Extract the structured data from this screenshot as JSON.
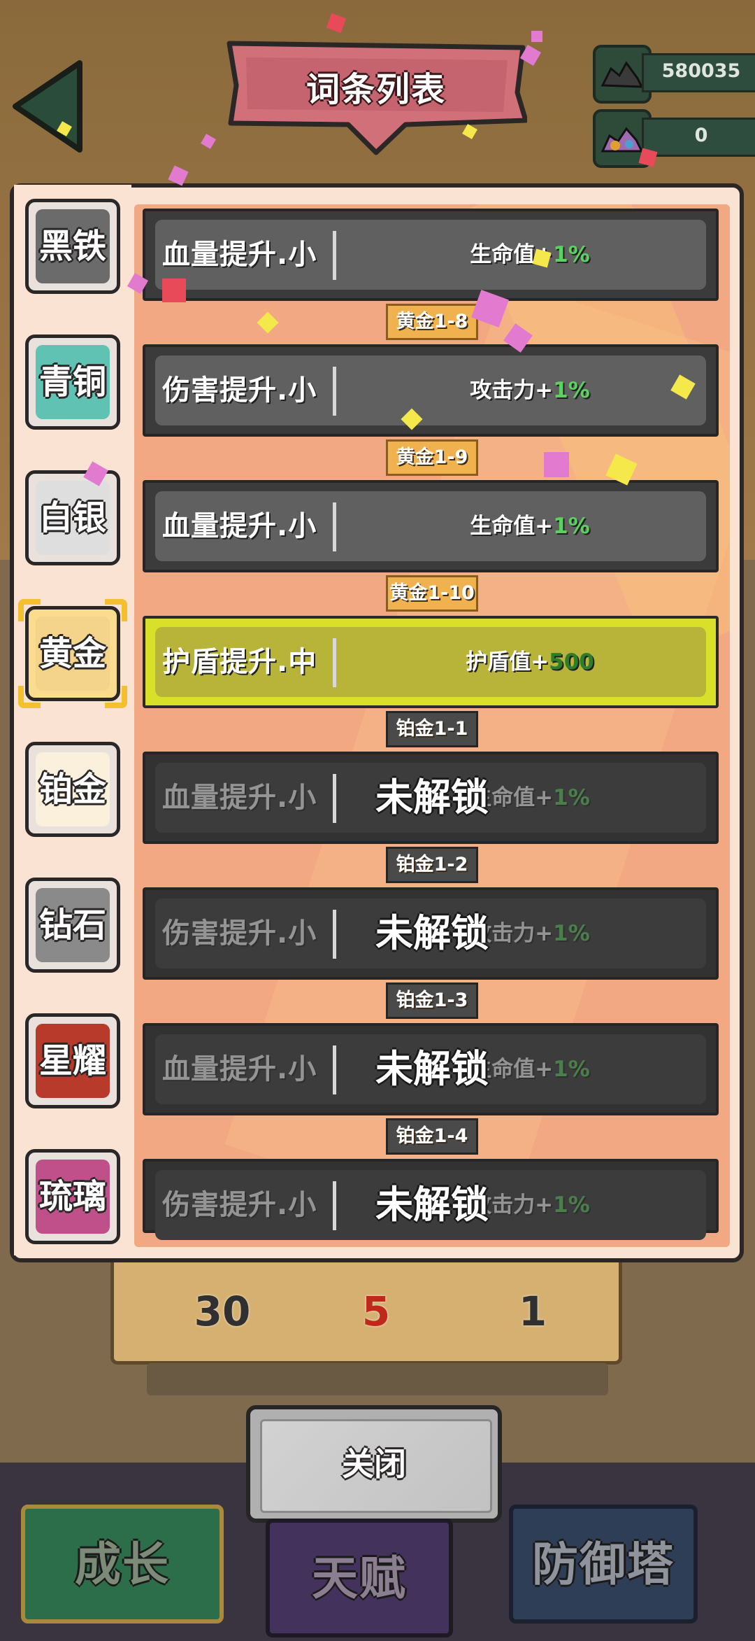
{
  "title": "词条列表",
  "resources": [
    {
      "icon": "ore-pile-icon",
      "value": "580035"
    },
    {
      "icon": "gem-pile-icon",
      "value": "0"
    }
  ],
  "tiers": [
    {
      "label": "黑铁",
      "selected": false,
      "color": "#6b6b6b"
    },
    {
      "label": "青铜",
      "selected": false,
      "color": "#5fc2b2"
    },
    {
      "label": "白银",
      "selected": false,
      "color": "#dedede"
    },
    {
      "label": "黄金",
      "selected": true,
      "color": "#f4d48a"
    },
    {
      "label": "铂金",
      "selected": false,
      "color": "#fbf0dc"
    },
    {
      "label": "钻石",
      "selected": false,
      "color": "#8a8a8a"
    },
    {
      "label": "星耀",
      "selected": false,
      "color": "#b83a2a"
    },
    {
      "label": "琉璃",
      "selected": false,
      "color": "#c0508a"
    }
  ],
  "rows": [
    {
      "name": "血量提升.小",
      "effect_label": "生命值+",
      "effect_value": "1%",
      "state": "normal"
    },
    {
      "name": "伤害提升.小",
      "effect_label": "攻击力+",
      "effect_value": "1%",
      "state": "normal"
    },
    {
      "name": "血量提升.小",
      "effect_label": "生命值+",
      "effect_value": "1%",
      "state": "normal"
    },
    {
      "name": "护盾提升.中",
      "effect_label": "护盾值+",
      "effect_value": "500",
      "state": "selected"
    },
    {
      "name": "血量提升.小",
      "effect_label": "生命值+",
      "effect_value": "1%",
      "state": "locked"
    },
    {
      "name": "伤害提升.小",
      "effect_label": "攻击力+",
      "effect_value": "1%",
      "state": "locked"
    },
    {
      "name": "血量提升.小",
      "effect_label": "生命值+",
      "effect_value": "1%",
      "state": "locked"
    },
    {
      "name": "伤害提升.小",
      "effect_label": "攻击力+",
      "effect_value": "1%",
      "state": "locked"
    }
  ],
  "level_labels": [
    "黄金1-8",
    "黄金1-9",
    "黄金1-10",
    "铂金1-1",
    "铂金1-2",
    "铂金1-3",
    "铂金1-4"
  ],
  "lock_text": "未解锁",
  "counts": [
    "30",
    "5",
    "1"
  ],
  "close_label": "关闭",
  "tabs": [
    "成长",
    "天赋",
    "防御塔"
  ]
}
